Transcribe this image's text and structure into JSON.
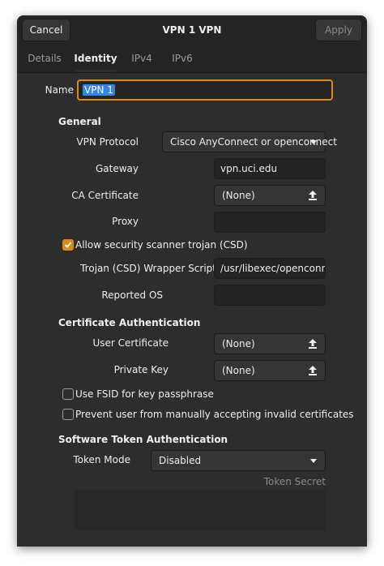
{
  "header": {
    "cancel_label": "Cancel",
    "title": "VPN 1 VPN",
    "apply_label": "Apply"
  },
  "tabs": [
    {
      "label": "Details",
      "active": false
    },
    {
      "label": "Identity",
      "active": true
    },
    {
      "label": "IPv4",
      "active": false
    },
    {
      "label": "IPv6",
      "active": false
    }
  ],
  "identity": {
    "name_label": "Name",
    "name_value": "VPN 1"
  },
  "general": {
    "heading": "General",
    "protocol_label": "VPN Protocol",
    "protocol_value": "Cisco AnyConnect or openconnect",
    "gateway_label": "Gateway",
    "gateway_value": "vpn.uci.edu",
    "ca_label": "CA Certificate",
    "ca_value": "(None)",
    "proxy_label": "Proxy",
    "proxy_value": "",
    "csd_label": "Allow security scanner trojan (CSD)",
    "csd_checked": true,
    "trojan_label": "Trojan (CSD) Wrapper Script",
    "trojan_value": "/usr/libexec/openconnect",
    "os_label": "Reported OS",
    "os_value": ""
  },
  "cert_auth": {
    "heading": "Certificate Authentication",
    "user_cert_label": "User Certificate",
    "user_cert_value": "(None)",
    "private_key_label": "Private Key",
    "private_key_value": "(None)",
    "fsid_label": "Use FSID for key passphrase",
    "fsid_checked": false,
    "prevent_label": "Prevent user from manually accepting invalid certificates",
    "prevent_checked": false
  },
  "token_auth": {
    "heading": "Software Token Authentication",
    "mode_label": "Token Mode",
    "mode_value": "Disabled",
    "secret_label": "Token Secret",
    "secret_value": ""
  },
  "colors": {
    "accent": "#d98a1e",
    "selection": "#3584e4",
    "window_bg": "#2d2d2d",
    "header_bg": "#242424"
  }
}
